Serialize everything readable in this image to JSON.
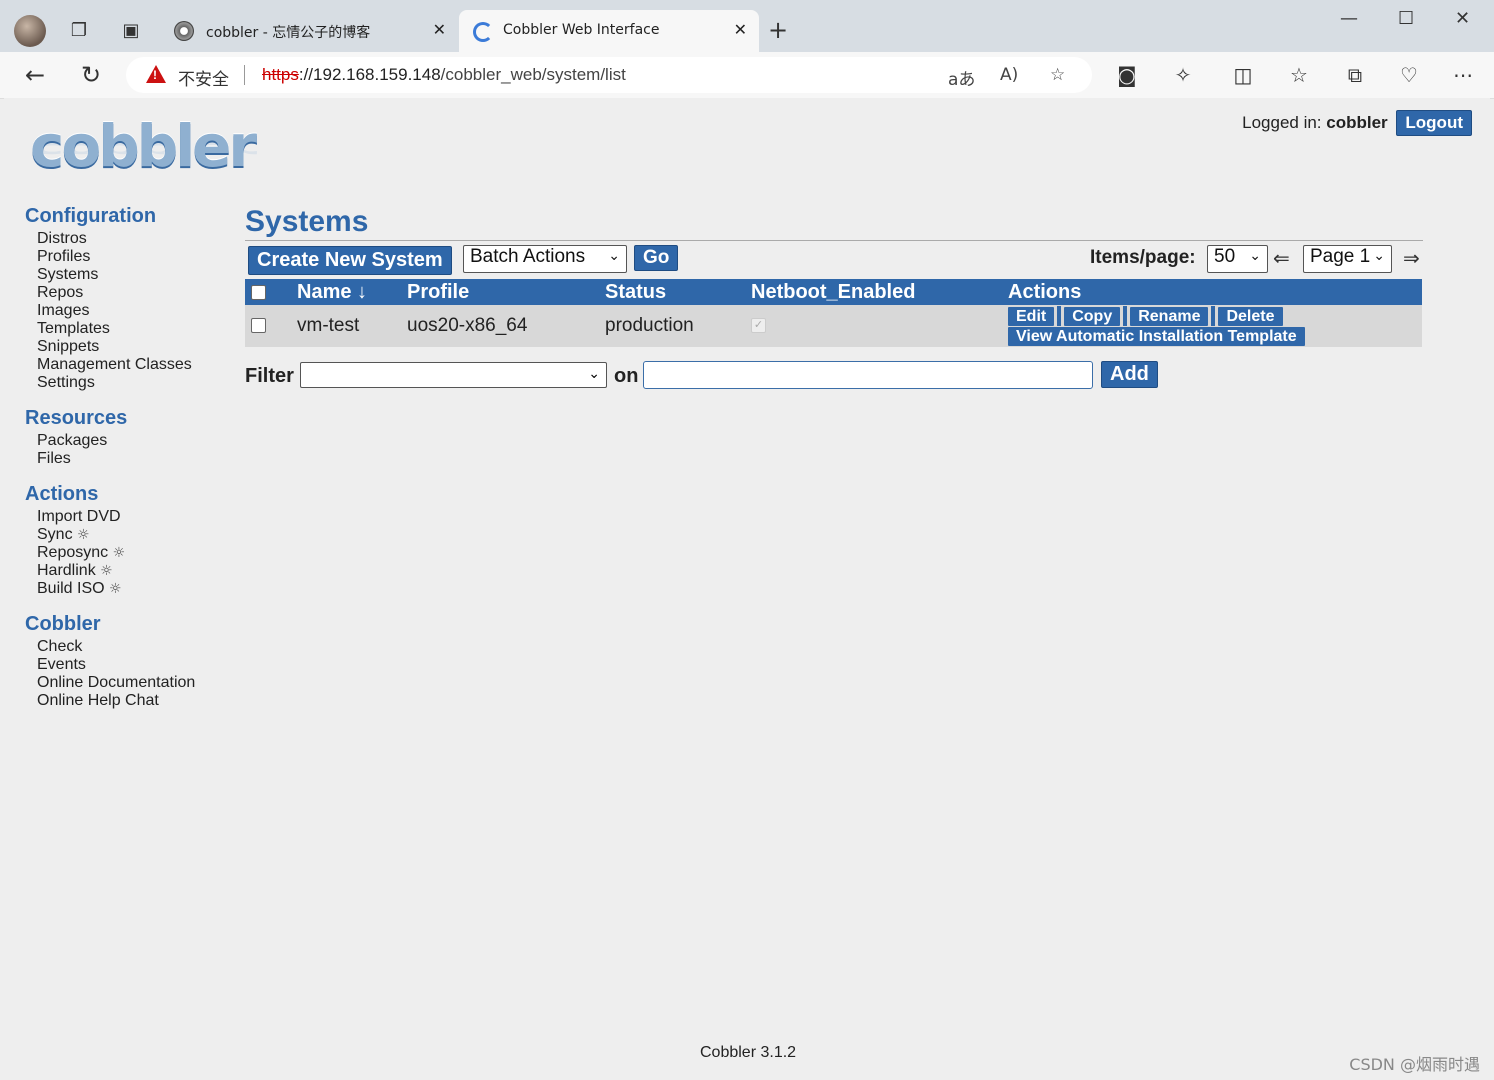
{
  "browser": {
    "tabs": [
      {
        "title": "cobbler - 忘情公子的博客",
        "active": false
      },
      {
        "title": "Cobbler Web Interface",
        "active": true
      }
    ],
    "security_label": "不安全",
    "url_protocol": "https",
    "url_host": "://192.168.159.148",
    "url_path": "/cobbler_web/system/list",
    "icons": [
      "back-icon",
      "refresh-icon",
      "translate-icon",
      "read-aloud-icon",
      "favorite-star-icon",
      "extension-icon",
      "split-screen-icon",
      "favorites-icon",
      "collections-icon",
      "browser-essentials-icon",
      "more-icon"
    ]
  },
  "header": {
    "logo_text": "cobbler",
    "logged_in_label": "Logged in:",
    "username": "cobbler",
    "logout_label": "Logout"
  },
  "sidebar": {
    "sections": [
      {
        "title": "Configuration",
        "items": [
          "Distros",
          "Profiles",
          "Systems",
          "Repos",
          "Images",
          "Templates",
          "Snippets",
          "Management Classes",
          "Settings"
        ]
      },
      {
        "title": "Resources",
        "items": [
          "Packages",
          "Files"
        ]
      },
      {
        "title": "Actions",
        "items": [
          "Import DVD",
          "Sync",
          "Reposync",
          "Hardlink",
          "Build ISO"
        ]
      },
      {
        "title": "Cobbler",
        "items": [
          "Check",
          "Events",
          "Online Documentation",
          "Online Help Chat"
        ]
      }
    ]
  },
  "main": {
    "title": "Systems",
    "create_label": "Create New System",
    "batch_actions_label": "Batch Actions",
    "go_label": "Go",
    "items_per_page_label": "Items/page:",
    "items_per_page": "50",
    "page_label": "Page 1",
    "prev_arrow": "⇐",
    "next_arrow": "⇒",
    "table": {
      "columns": [
        "Name ↓",
        "Profile",
        "Status",
        "Netboot_Enabled",
        "Actions"
      ],
      "rows": [
        {
          "name": "vm-test",
          "profile": "uos20-x86_64",
          "status": "production",
          "netboot_enabled": true
        }
      ],
      "row_actions": [
        "Edit",
        "Copy",
        "Rename",
        "Delete"
      ],
      "row_action_template": "View Automatic Installation Template"
    },
    "filter_label": "Filter",
    "on_label": "on",
    "add_label": "Add"
  },
  "footer": {
    "version": "Cobbler 3.1.2",
    "watermark": "CSDN @烟雨时遇"
  },
  "colors": {
    "accent": "#2f67a9",
    "page_bg": "#eeeeee",
    "row_bg": "#d8d8d8"
  }
}
